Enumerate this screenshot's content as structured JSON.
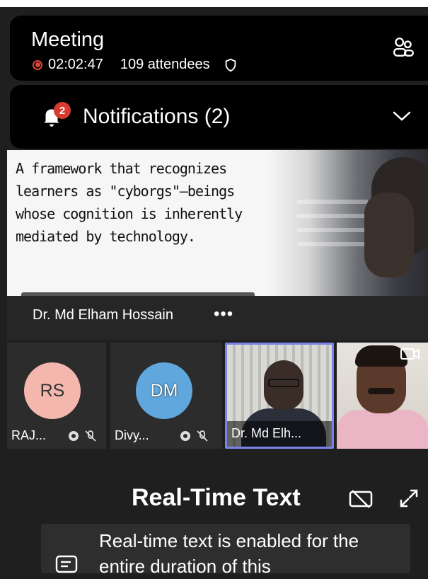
{
  "meeting": {
    "title": "Meeting",
    "duration": "02:02:47",
    "attendees": "109 attendees"
  },
  "notifications": {
    "label": "Notifications (2)",
    "badge_count": "2"
  },
  "slide": {
    "text_lines": [
      "A framework that recognizes",
      "learners as \"cyborgs\"—beings",
      "whose cognition is inherently",
      "mediated by technology."
    ]
  },
  "presenter": {
    "name": "Dr. Md Elham Hossain",
    "more_label": "•••"
  },
  "participants": [
    {
      "initials": "RS",
      "label": "RAJ...",
      "avatar_color": "#f4b7ae"
    },
    {
      "initials": "DM",
      "label": "Divy...",
      "avatar_color": "#5fa7dc"
    },
    {
      "label": "Dr. Md Elh..."
    },
    {
      "label": ""
    }
  ],
  "realtime_text": {
    "title": "Real-Time Text",
    "message": "Real-time text is enabled for the entire duration of this"
  },
  "colors": {
    "accent": "#7b83eb",
    "recording": "#e0453a",
    "badge": "#d93b2f"
  }
}
